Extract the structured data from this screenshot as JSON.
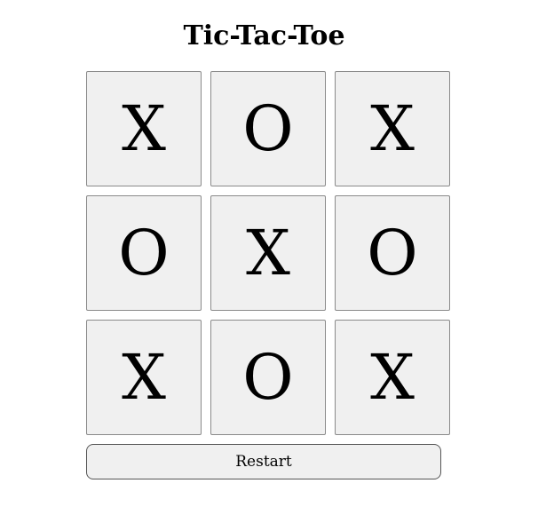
{
  "title": "Tic-Tac-Toe",
  "board": {
    "cells": [
      "X",
      "O",
      "X",
      "O",
      "X",
      "O",
      "X",
      "O",
      "X"
    ]
  },
  "restart_label": "Restart",
  "colors": {
    "cell_background": "#f0f0f0",
    "cell_border": "#8a8a8a",
    "text": "#000000"
  }
}
